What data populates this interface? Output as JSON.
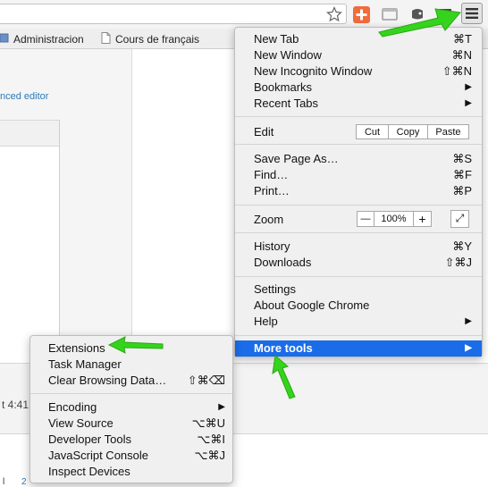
{
  "bookmarks": [
    {
      "icon": "folder-icon",
      "label": "Administracion"
    },
    {
      "icon": "page-icon",
      "label": "Cours de français"
    }
  ],
  "page": {
    "edit_link": "nced editor",
    "time_text": "t 4:41",
    "misc_1": "l",
    "misc_2": "2"
  },
  "chrome_menu": {
    "items_top": [
      {
        "label": "New Tab",
        "shortcut": "⌘T"
      },
      {
        "label": "New Window",
        "shortcut": "⌘N"
      },
      {
        "label": "New Incognito Window",
        "shortcut": "⇧⌘N"
      },
      {
        "label": "Bookmarks",
        "submenu": "▶"
      },
      {
        "label": "Recent Tabs",
        "submenu": "▶"
      }
    ],
    "edit": {
      "label": "Edit",
      "cut": "Cut",
      "copy": "Copy",
      "paste": "Paste"
    },
    "items_page": [
      {
        "label": "Save Page As…",
        "shortcut": "⌘S"
      },
      {
        "label": "Find…",
        "shortcut": "⌘F"
      },
      {
        "label": "Print…",
        "shortcut": "⌘P"
      }
    ],
    "zoom": {
      "label": "Zoom",
      "minus": "—",
      "value": "100%",
      "plus": "+",
      "fullscreen": "⤢"
    },
    "items_history": [
      {
        "label": "History",
        "shortcut": "⌘Y"
      },
      {
        "label": "Downloads",
        "shortcut": "⇧⌘J"
      }
    ],
    "items_settings": [
      {
        "label": "Settings"
      },
      {
        "label": "About Google Chrome"
      },
      {
        "label": "Help",
        "submenu": "▶"
      }
    ],
    "more_tools": {
      "label": "More tools",
      "submenu": "▶"
    }
  },
  "tools_menu": {
    "items_top": [
      {
        "label": "Extensions"
      },
      {
        "label": "Task Manager"
      },
      {
        "label": "Clear Browsing Data…",
        "shortcut": "⇧⌘⌫"
      }
    ],
    "items_bottom": [
      {
        "label": "Encoding",
        "submenu": "▶"
      },
      {
        "label": "View Source",
        "shortcut": "⌥⌘U"
      },
      {
        "label": "Developer Tools",
        "shortcut": "⌥⌘I"
      },
      {
        "label": "JavaScript Console",
        "shortcut": "⌥⌘J"
      },
      {
        "label": "Inspect Devices"
      }
    ]
  },
  "colors": {
    "highlight": "#1a6ce8",
    "arrow": "#35d41c"
  }
}
